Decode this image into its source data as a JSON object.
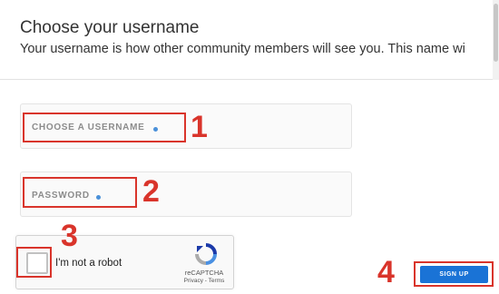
{
  "header": {
    "title": "Choose your username",
    "subtitle": "Your username is how other community members will see you. This name wi"
  },
  "form": {
    "username_placeholder": "CHOOSE A USERNAME",
    "password_placeholder": "PASSWORD"
  },
  "recaptcha": {
    "label": "I'm not a robot",
    "brand": "reCAPTCHA",
    "links": "Privacy - Terms"
  },
  "signup": {
    "label": "SIGN UP"
  },
  "annotations": {
    "n1": "1",
    "n2": "2",
    "n3": "3",
    "n4": "4"
  },
  "colors": {
    "highlight": "#d9342b",
    "button": "#1a73d6",
    "dot": "#4a90d9"
  }
}
